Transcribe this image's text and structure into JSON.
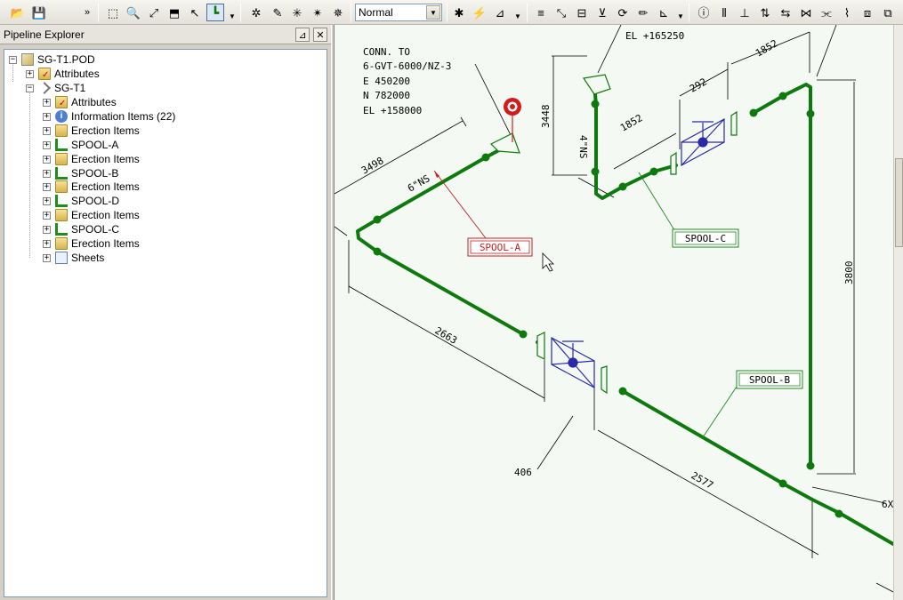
{
  "toolbar": {
    "view_mode_value": "Normal",
    "overflow_label": "»"
  },
  "explorer": {
    "title": "Pipeline Explorer",
    "pin_label": "⊿",
    "close_label": "✕",
    "root": "SG-T1.POD",
    "items": {
      "attributes_root": "Attributes",
      "pipe": "SG-T1",
      "attributes": "Attributes",
      "information_items": "Information Items (22)",
      "erection_1": "Erection Items",
      "spool_a": "SPOOL-A",
      "erection_2": "Erection Items",
      "spool_b": "SPOOL-B",
      "erection_3": "Erection Items",
      "spool_d": "SPOOL-D",
      "erection_4": "Erection Items",
      "spool_c": "SPOOL-C",
      "erection_5": "Erection Items",
      "sheets": "Sheets"
    }
  },
  "drawing": {
    "conn_lines": [
      "CONN. TO",
      "6-GVT-6000/NZ-3",
      "E 450200",
      "N 782000",
      "EL +158000"
    ],
    "elevation_label": "EL +165250",
    "dims": {
      "d3498": "3498",
      "d2663": "2663",
      "d406": "406",
      "d2577": "2577",
      "d3448": "3448",
      "d1852a": "1852",
      "d292": "292",
      "d1852b": "1852",
      "d3800": "3800",
      "d6x": "6X"
    },
    "sizes": {
      "ns6": "6\"NS",
      "ns4": "4\"NS"
    },
    "spools": {
      "a": "SPOOL-A",
      "b": "SPOOL-B",
      "c": "SPOOL-C"
    },
    "colors": {
      "pipe": "#0e7a0e",
      "dim": "#000000",
      "valve": "#2a2aa8",
      "spool_a": "#c02020",
      "spool_bc": "#1c8a1c",
      "marker": "#d61a1a",
      "canvas": "#f4f9f4"
    }
  }
}
